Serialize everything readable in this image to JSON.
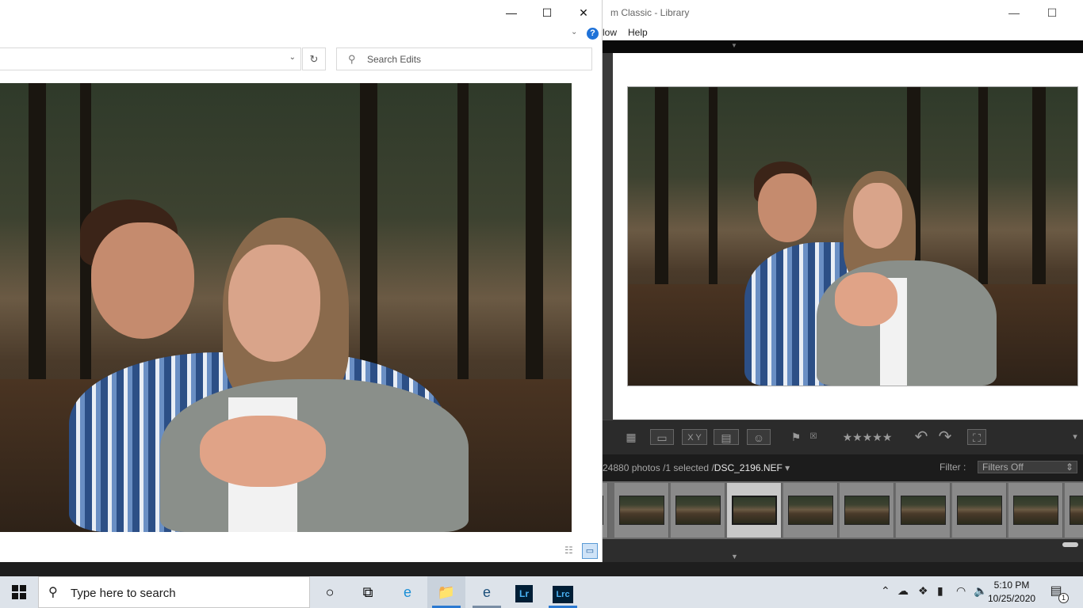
{
  "lightroom": {
    "title": "m Classic - Library",
    "minimize": "—",
    "maximize": "☐",
    "menu": [
      "low",
      "Help"
    ],
    "toolbar": {
      "grid_icon": "grid-view-icon",
      "loupe_icon": "loupe-view-icon",
      "compare_label": "X Y",
      "survey_icon": "survey-view-icon",
      "people_icon": "people-view-icon",
      "flag_icon": "flag-icon",
      "reject_icon": "reject-flag-icon",
      "stars": "★★★★★",
      "rotate_left": "↶",
      "rotate_right": "↷",
      "crop_icon": "crop-icon",
      "more": "▾"
    },
    "filmstrip": {
      "info_prefix": "24880 photos /1 selected /",
      "filename": "DSC_2196.NEF",
      "dropdown": "▾",
      "filter_label": "Filter :",
      "filter_value": "Filters Off",
      "filter_arrows": "⇕"
    },
    "thumbnails": [
      {
        "selected": false
      },
      {
        "selected": false
      },
      {
        "selected": false
      },
      {
        "selected": true
      },
      {
        "selected": false
      },
      {
        "selected": false
      },
      {
        "selected": false
      },
      {
        "selected": false
      },
      {
        "selected": false
      },
      {
        "selected": false
      }
    ]
  },
  "photos_app": {
    "minimize": "—",
    "maximize": "☐",
    "close": "✕",
    "nav_chevron": "⌄",
    "help_label": "?",
    "address_dropdown": "⌄",
    "refresh_label": "↻",
    "search_icon": "search-icon",
    "search_placeholder": "Search Edits",
    "view_details": "☷",
    "view_preview": "▭"
  },
  "taskbar": {
    "start_icon": "windows-start-icon",
    "search_placeholder": "Type here to search",
    "cortana_icon": "cortana-icon",
    "taskview_icon": "task-view-icon",
    "apps": [
      {
        "name": "edge",
        "label": "e"
      },
      {
        "name": "file-explorer",
        "label": "📁"
      },
      {
        "name": "photos",
        "label": "e"
      },
      {
        "name": "lightroom",
        "label": "Lr"
      },
      {
        "name": "lightroom-classic",
        "label": "Lrc"
      }
    ],
    "tray": {
      "chevron": "⌃",
      "cloud": "☁",
      "dropbox": "❖",
      "battery": "▮",
      "network": "◠",
      "volume": "🔈"
    },
    "time": "5:10 PM",
    "date": "10/25/2020",
    "notification_count": "1"
  },
  "colors": {
    "accent": "#2b79d1",
    "lr_panel": "#2b2b2b",
    "help_blue": "#1f72d8"
  }
}
